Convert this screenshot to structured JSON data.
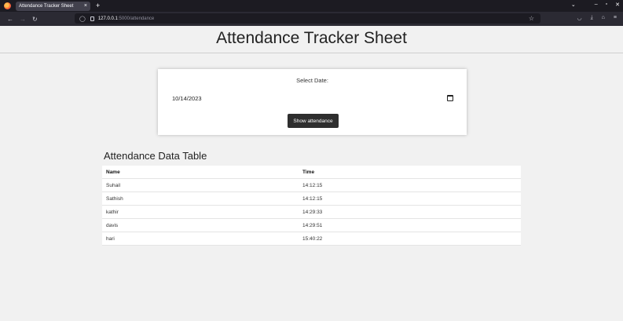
{
  "browser": {
    "tab_title": "Attendance Tracker Sheet",
    "tab_close": "×",
    "new_tab": "+",
    "url_host": "127.0.0.1",
    "url_path": ":5000/attendance",
    "icons": [
      "firefox-icon",
      "back-icon",
      "forward-icon",
      "reload-icon",
      "shield-icon",
      "page-icon",
      "star-icon",
      "pocket-icon",
      "download-icon",
      "extensions-icon",
      "menu-icon"
    ]
  },
  "page": {
    "title": "Attendance Tracker Sheet",
    "date_label": "Select Date:",
    "date_value": "10/14/2023",
    "show_button": "Show attendance",
    "table_title": "Attendance Data Table",
    "columns": [
      "Name",
      "Time"
    ],
    "rows": [
      {
        "name": "Suhail",
        "time": "14:12:15"
      },
      {
        "name": "Sathish",
        "time": "14:12:15"
      },
      {
        "name": "kathir",
        "time": "14:29:33"
      },
      {
        "name": "davis",
        "time": "14:29:51"
      },
      {
        "name": "hari",
        "time": "15:40:22"
      }
    ]
  },
  "colors": {
    "page_bg": "#f1f1f1",
    "button_bg": "#2e2e2e",
    "browser_dark": "#1c1b22"
  }
}
